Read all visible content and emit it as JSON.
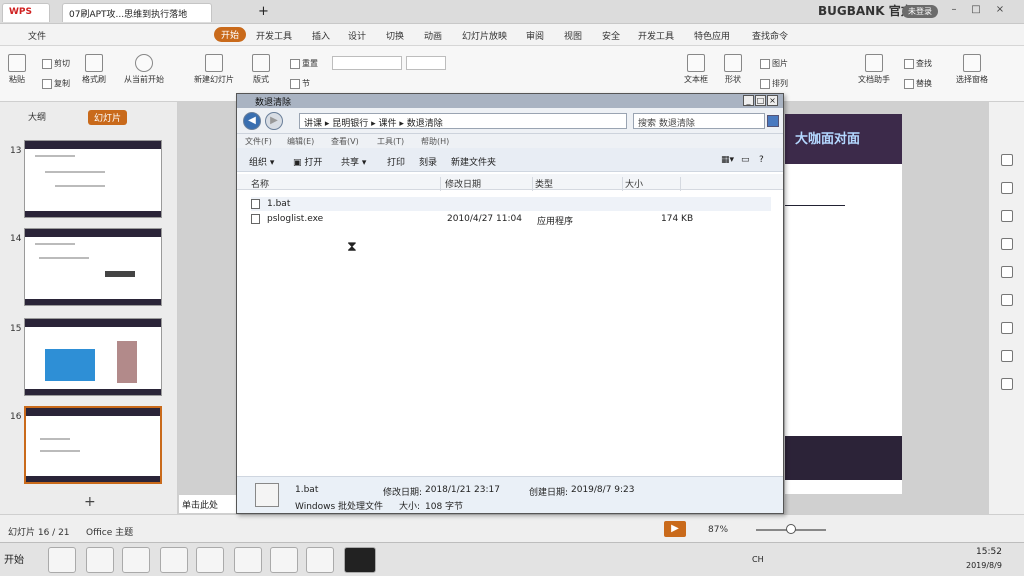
{
  "app": {
    "name": "WPS",
    "doc_tab": "07刷APT攻...思维到执行落地",
    "user_badge": "未登录",
    "brand_watermark": "BUGBANK 官方"
  },
  "ribbon_tabs": [
    "文件",
    "开始",
    "开发工具",
    "插入",
    "设计",
    "切换",
    "动画",
    "幻灯片放映",
    "审阅",
    "视图",
    "安全",
    "开发工具",
    "特色应用",
    "查找命令"
  ],
  "ribbon_tab_active": "开始",
  "ribbon": {
    "paste": "粘贴",
    "cut": "剪切",
    "copy": "复制",
    "format_painter": "格式刷",
    "from_start": "从当前开始",
    "new_slide": "新建幻灯片",
    "layout": "版式",
    "reset": "重置",
    "section": "节",
    "textbox": "文本框",
    "shapes": "形状",
    "picture": "图片",
    "arrange": "排列",
    "doc_helper": "文档助手",
    "find": "查找",
    "replace": "替换",
    "select_pane": "选择窗格"
  },
  "left_pane": {
    "tab_outline": "大纲",
    "tab_slides": "幻灯片",
    "thumb_numbers": [
      "13",
      "14",
      "15",
      "16"
    ]
  },
  "slide": {
    "banner_text": "大咖面对面"
  },
  "notes_placeholder": "单击此处",
  "status": {
    "slide_counter": "幻灯片 16 / 21",
    "theme": "Office 主题",
    "zoom": "87%"
  },
  "taskbar": {
    "start": "开始",
    "time": "15:52",
    "date": "2019/8/9",
    "ime": "CH"
  },
  "explorer": {
    "title": "数退清除",
    "address_parts": [
      "讲课",
      "昆明银行",
      "课件",
      "数退清除"
    ],
    "search_placeholder": "搜索 数退清除",
    "menu": [
      "文件(F)",
      "编辑(E)",
      "查看(V)",
      "工具(T)",
      "帮助(H)"
    ],
    "toolbar": [
      "组织",
      "打开",
      "共享",
      "打印",
      "刻录",
      "新建文件夹"
    ],
    "columns": [
      "名称",
      "修改日期",
      "类型",
      "大小"
    ],
    "files": [
      {
        "name": "1.bat",
        "modified": "",
        "type": "",
        "size": ""
      },
      {
        "name": "psloglist.exe",
        "modified": "2010/4/27 11:04",
        "type": "应用程序",
        "size": "174 KB"
      }
    ],
    "details": {
      "filename": "1.bat",
      "modified_label": "修改日期:",
      "modified": "2018/1/21 23:17",
      "created_label": "创建日期:",
      "created": "2019/8/7 9:23",
      "filetype": "Windows 批处理文件",
      "size_label": "大小:",
      "size": "108 字节"
    }
  },
  "colors": {
    "accent": "#c96a1b",
    "slide_dark": "#2c2338",
    "nav_blue": "#3a6fb0"
  }
}
